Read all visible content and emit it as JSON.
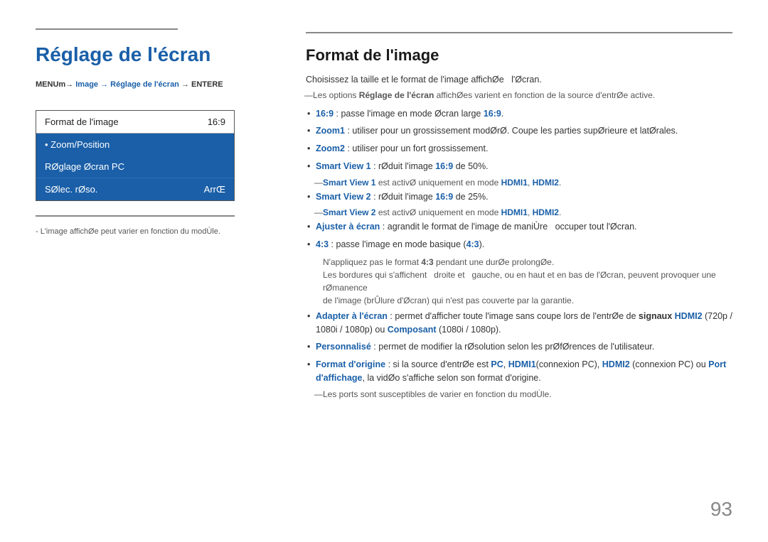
{
  "left": {
    "title": "Réglage de l'écran",
    "menu_path": "MENUm→ Image → Réglage de l'écran → ENTERE",
    "menu_items": [
      {
        "label": "Format de l'image",
        "value": "16:9",
        "style": "white"
      },
      {
        "label": "• Zoom/Position",
        "value": "",
        "style": "blue"
      },
      {
        "label": "RØglage Øcran PC",
        "value": "",
        "style": "blue"
      },
      {
        "label": "SØlec. rØso.",
        "value": "ArrŒ",
        "style": "blue-last"
      }
    ],
    "footnote": "- L'image affichØe peut varier en fonction du modÙle."
  },
  "right": {
    "title": "Format de l'image",
    "intro": "Choisissez la taille et le format de l'image affichØe  l'Øcran.",
    "note": "Les options Réglage de l'écran affichØes varient en fonction de la source d'entrØe active.",
    "items": [
      {
        "text_before": "",
        "bold_blue": "16:9",
        "text_after": " : passe l'image en mode Øcran large ",
        "bold_blue2": "16:9",
        "text_end": "."
      },
      {
        "text_before": "",
        "bold_blue": "Zoom1",
        "text_after": " :  utiliser pour un grossissement modØrØ. Coupe les parties supØrieure et latØrales.",
        "bold_blue2": "",
        "text_end": ""
      },
      {
        "text_before": "",
        "bold_blue": "Zoom2",
        "text_after": " :  utiliser pour un fort grossissement.",
        "bold_blue2": "",
        "text_end": ""
      },
      {
        "text_before": "",
        "bold_blue": "Smart View 1",
        "text_after": " : rØduit l'image ",
        "bold_blue2": "16:9",
        "text_end": " de 50%.",
        "subnote": "Smart View 1 est activØ uniquement en mode HDMI1, HDMI2."
      },
      {
        "text_before": "",
        "bold_blue": "Smart View 2",
        "text_after": " : rØduit l'image ",
        "bold_blue2": "16:9",
        "text_end": " de 25%.",
        "subnote": "Smart View 2 est activØ uniquement en mode HDMI1, HDMI2."
      },
      {
        "text_before": "",
        "bold_blue": "Ajuster à écran",
        "text_after": " : agrandit le format de l'image de maniÙre  occuper tout l'Øcran.",
        "bold_blue2": "",
        "text_end": ""
      },
      {
        "text_before": "",
        "bold_blue": "4:3",
        "text_after": " : passe l'image en mode basique (",
        "bold_blue2": "4:3",
        "text_end": ").",
        "warning": true
      },
      {
        "text_before": "",
        "bold_blue": "Adapter à l'écran",
        "text_after": " : permet d'afficher toute l'image sans coupe lors de l'entrØe de signaux HDMI2 (720p / 1080i / 1080p) ou Composant (1080i / 1080p).",
        "bold_blue2": "",
        "text_end": ""
      },
      {
        "text_before": "",
        "bold_blue": "Personnalisé",
        "text_after": " : permet de modifier la rØsolution selon les prØfØrences de l'utilisateur.",
        "bold_blue2": "",
        "text_end": ""
      },
      {
        "text_before": "",
        "bold_blue": "Format d'origine",
        "text_after": " : si la source d'entrØe est PC, HDMI1(connexion PC), HDMI2 (connexion PC) ou Port d'affichage, la vidØo s'affiche selon son format d'origine.",
        "bold_blue2": "",
        "text_end": "",
        "subnote2": "Les ports sont susceptibles de varier en fonction du modÙle."
      }
    ]
  },
  "page_number": "93"
}
